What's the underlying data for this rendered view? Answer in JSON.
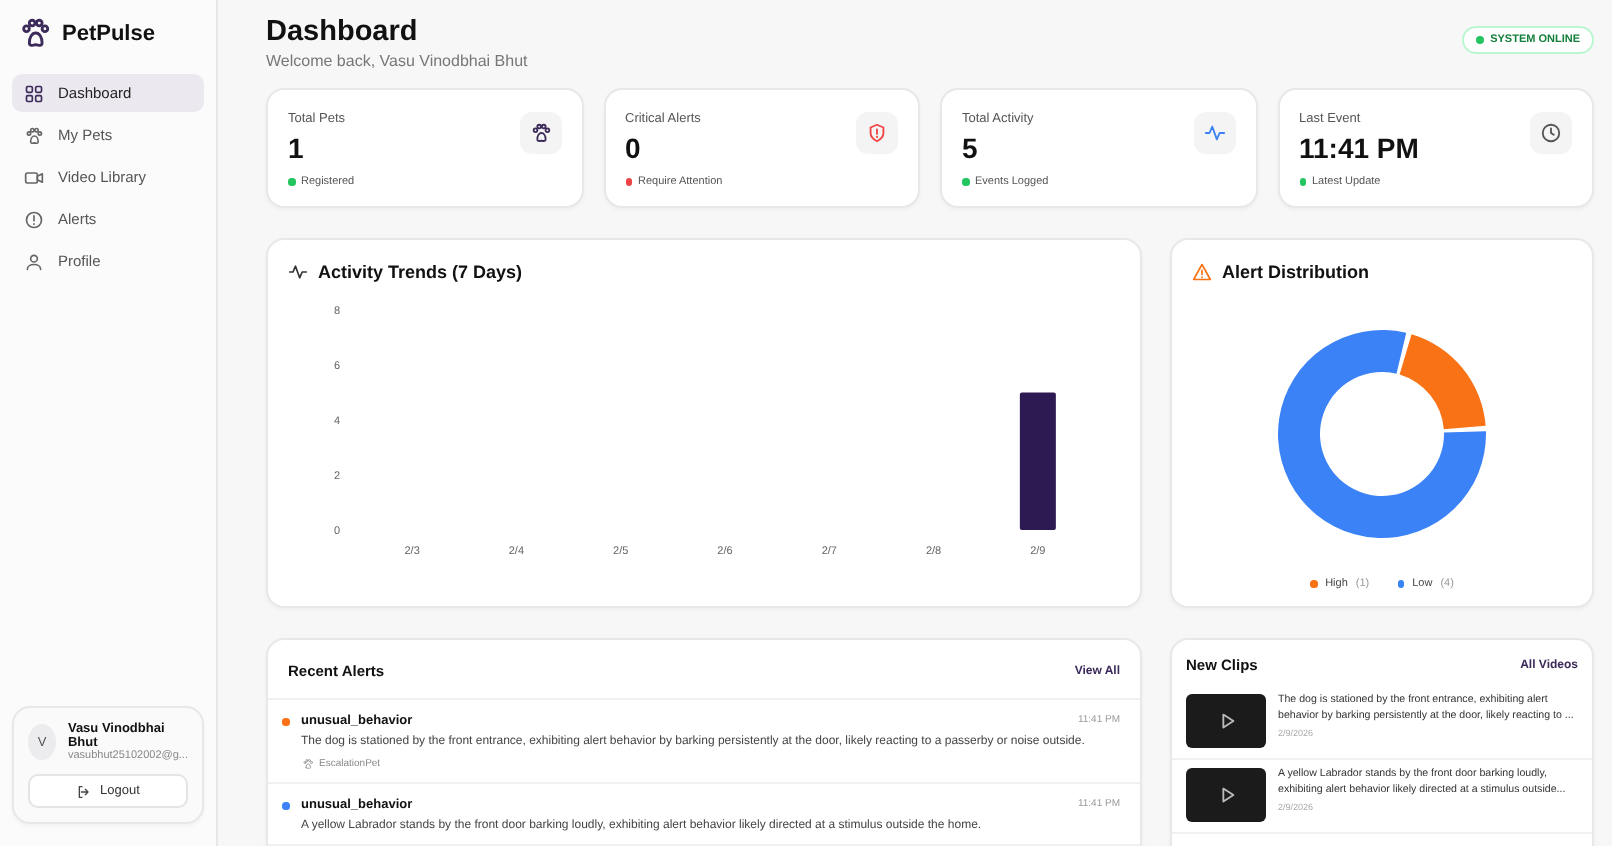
{
  "brand": {
    "name": "PetPulse"
  },
  "nav": [
    {
      "label": "Dashboard",
      "kind": "grid",
      "selected": true
    },
    {
      "label": "My Pets",
      "kind": "paw",
      "selected": false
    },
    {
      "label": "Video Library",
      "kind": "video",
      "selected": false
    },
    {
      "label": "Alerts",
      "kind": "alert",
      "selected": false
    },
    {
      "label": "Profile",
      "kind": "user",
      "selected": false
    }
  ],
  "user": {
    "initial": "V",
    "name": "Vasu Vinodbhai Bhut",
    "email": "vasubhut25102002@g...",
    "logout": "Logout"
  },
  "header": {
    "title": "Dashboard",
    "subtitle": "Welcome back, Vasu Vinodbhai Bhut",
    "status": "SYSTEM ONLINE"
  },
  "stats": [
    {
      "label": "Total Pets",
      "value": "1",
      "note": "Registered",
      "kind": "paw",
      "color": "#22c55e"
    },
    {
      "label": "Critical Alerts",
      "value": "0",
      "note": "Require Attention",
      "kind": "shield",
      "color": "#ef4444"
    },
    {
      "label": "Total Activity",
      "value": "5",
      "note": "Events Logged",
      "kind": "pulse",
      "color": "#22c55e"
    },
    {
      "label": "Last Event",
      "value": "11:41 PM",
      "note": "Latest Update",
      "kind": "clock",
      "color": "#22c55e"
    }
  ],
  "activity": {
    "title": "Activity Trends (7 Days)",
    "chart_data": {
      "type": "bar",
      "categories": [
        "2/3",
        "2/4",
        "2/5",
        "2/6",
        "2/7",
        "2/8",
        "2/9"
      ],
      "series": [
        {
          "color": "#2e1a52",
          "values": [
            0,
            0,
            0,
            0,
            0,
            0,
            5
          ]
        }
      ],
      "ylim": [
        0,
        8
      ],
      "yticks": [
        0,
        2,
        4,
        6,
        8
      ]
    }
  },
  "distribution": {
    "title": "Alert Distribution",
    "chart_data": {
      "type": "donut",
      "categories": [
        "High",
        "Low"
      ],
      "values": [
        20,
        80
      ]
    },
    "legend": [
      {
        "count": "(1)",
        "color": "#f97316"
      },
      {
        "count": "(4)",
        "color": "#3b82f6"
      }
    ]
  },
  "recent_alerts": {
    "title": "Recent Alerts",
    "link": "View All",
    "items": [
      {
        "type": "unusual_behavior",
        "time": "11:41 PM",
        "description": "The dog is stationed by the front entrance, exhibiting alert behavior by barking persistently at the door, likely reacting to a passerby or noise outside.",
        "pet": "EscalationPet",
        "color": "#f97316"
      },
      {
        "type": "unusual_behavior",
        "time": "11:41 PM",
        "description": "A yellow Labrador stands by the front door barking loudly, exhibiting alert behavior likely directed at a stimulus outside the home.",
        "color": "#3b82f6"
      }
    ]
  },
  "new_clips": {
    "title": "New Clips",
    "link": "All Videos",
    "items": [
      {
        "description": "The dog is stationed by the front entrance, exhibiting alert behavior by barking persistently at the door, likely reacting to ...",
        "date": "2/9/2026"
      },
      {
        "description": "A yellow Labrador stands by the front door barking loudly, exhibiting alert behavior likely directed at a stimulus outside...",
        "date": "2/9/2026"
      }
    ]
  }
}
